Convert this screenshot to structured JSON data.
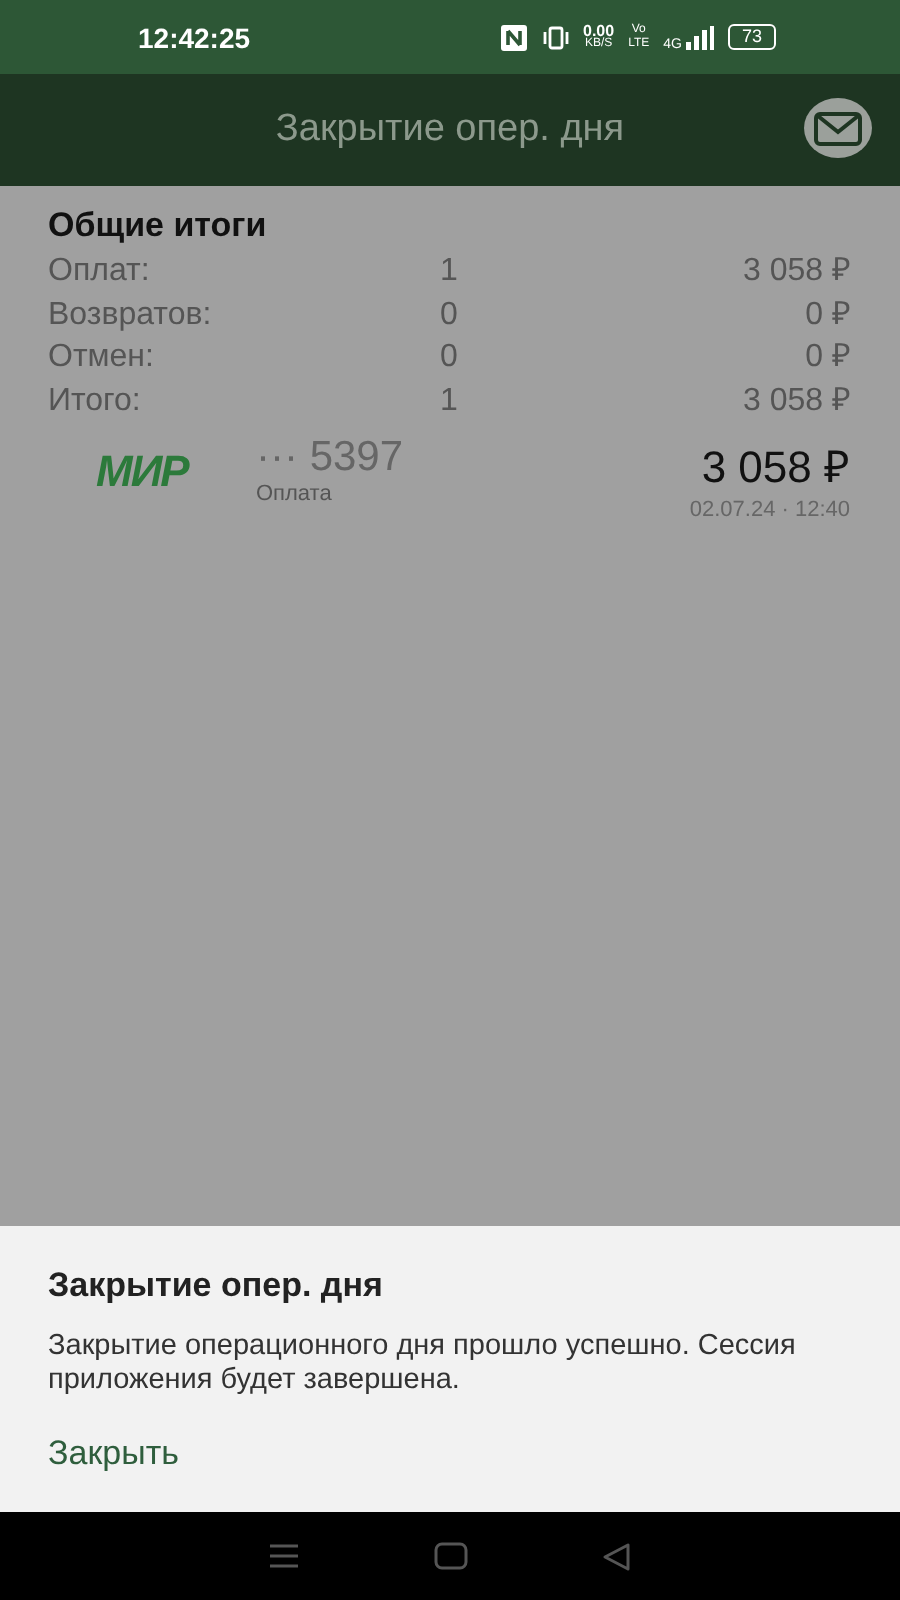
{
  "status_bar": {
    "time": "12:42:25",
    "speed": "0.00",
    "speed_unit": "KB/S",
    "volte_top": "Vo",
    "volte_bottom": "LTE",
    "network": "4G",
    "battery": "73"
  },
  "app_bar": {
    "title": "Закрытие опер. дня"
  },
  "summary": {
    "title": "Общие итоги",
    "rows": [
      {
        "label": "Оплат:",
        "count": "1",
        "amount": "3 058 ₽"
      },
      {
        "label": "Возвратов:",
        "count": "0",
        "amount": "0 ₽"
      },
      {
        "label": "Отмен:",
        "count": "0",
        "amount": "0 ₽"
      },
      {
        "label": "Итого:",
        "count": "1",
        "amount": "3 058 ₽"
      }
    ]
  },
  "transactions": [
    {
      "brand": "МИР",
      "card": "··· 5397",
      "type": "Оплата",
      "amount": "3 058 ₽",
      "datetime": "02.07.24 · 12:40"
    }
  ],
  "dialog": {
    "title": "Закрытие опер. дня",
    "message": "Закрытие операционного дня прошло успешно. Сессия приложения будет завершена.",
    "buttons": [
      "Закрыть"
    ]
  }
}
